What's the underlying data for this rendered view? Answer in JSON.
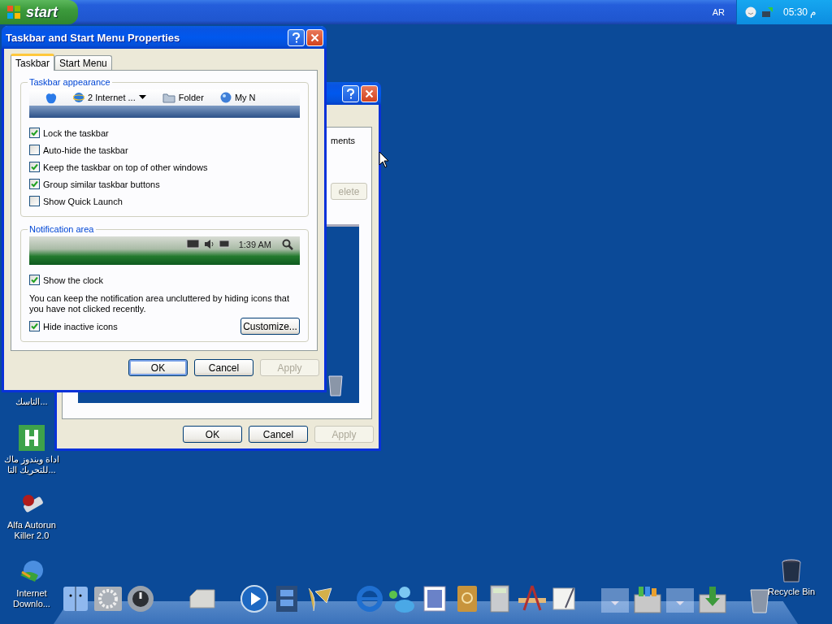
{
  "top_bar": {
    "start_label": "start",
    "language": "AR",
    "clock": "05:30 م"
  },
  "desktop_icons": [
    {
      "kind": "partial",
      "label": "التاسك..."
    },
    {
      "kind": "h-app",
      "label": "اداة ويندوز ماك\nللتحريك التا..."
    },
    {
      "kind": "usb",
      "label": "Alfa Autorun\nKiller 2.0"
    },
    {
      "kind": "globe",
      "label": "Internet\nDownlo..."
    }
  ],
  "recycle_bin": {
    "label": "Recycle Bin"
  },
  "background_window": {
    "text_fragment": "ments",
    "side_button": {
      "label": "elete",
      "disabled": true
    },
    "buttons": [
      {
        "label": "OK",
        "disabled": false,
        "default": false
      },
      {
        "label": "Cancel",
        "disabled": false,
        "default": false
      },
      {
        "label": "Apply",
        "disabled": true,
        "default": false
      }
    ]
  },
  "dialog": {
    "title": "Taskbar and Start Menu Properties",
    "tabs": [
      {
        "label": "Taskbar",
        "selected": true
      },
      {
        "label": "Start Menu",
        "selected": false
      }
    ],
    "appearance": {
      "title": "Taskbar appearance",
      "preview_items": [
        {
          "kind": "ie",
          "label": "2 Internet ..."
        },
        {
          "kind": "folder",
          "label": "Folder"
        },
        {
          "kind": "globe",
          "label": "My N"
        }
      ],
      "options": [
        {
          "label": "Lock the taskbar",
          "checked": true
        },
        {
          "label": "Auto-hide the taskbar",
          "checked": false
        },
        {
          "label": "Keep the taskbar on top of other windows",
          "checked": true
        },
        {
          "label": "Group similar taskbar buttons",
          "checked": true
        },
        {
          "label": "Show Quick Launch",
          "checked": false
        }
      ]
    },
    "notification": {
      "title": "Notification area",
      "preview_clock": "1:39 AM",
      "clock_option": {
        "label": "Show the clock",
        "checked": true
      },
      "description": "You can keep the notification area uncluttered by hiding icons that you have not clicked recently.",
      "hide_option": {
        "label": "Hide inactive icons",
        "checked": true
      },
      "customize_button": "Customize..."
    },
    "buttons": [
      {
        "label": "OK",
        "disabled": false,
        "default": true
      },
      {
        "label": "Cancel",
        "disabled": false,
        "default": false
      },
      {
        "label": "Apply",
        "disabled": true,
        "default": false
      }
    ]
  }
}
